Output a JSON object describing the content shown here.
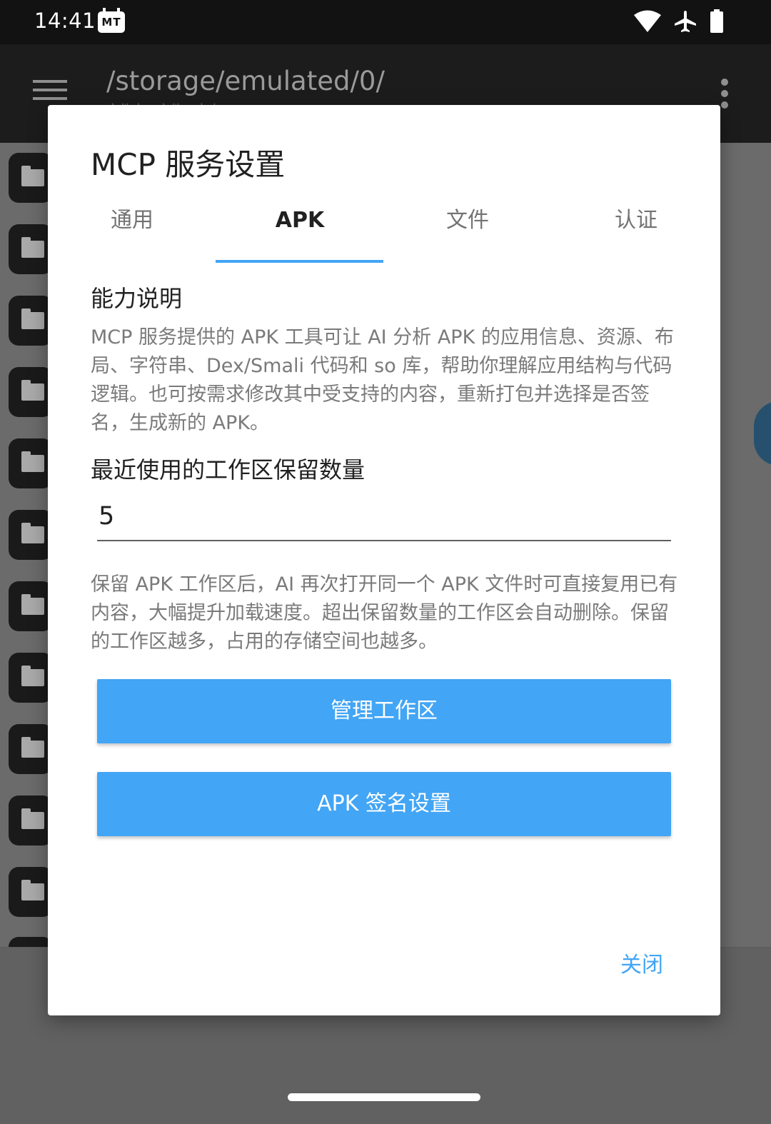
{
  "status_bar": {
    "time": "14:41",
    "app_badge": "MT",
    "icons": [
      "wifi-icon",
      "airplane-icon",
      "battery-icon"
    ]
  },
  "app_bar": {
    "path": "/storage/emulated/0/",
    "subtitle": "文件夹 · 文件 · 大小"
  },
  "dialog": {
    "title": "MCP 服务设置",
    "tabs": [
      {
        "label": "通用",
        "active": false
      },
      {
        "label": "APK",
        "active": true
      },
      {
        "label": "文件",
        "active": false
      },
      {
        "label": "认证",
        "active": false
      }
    ],
    "capability": {
      "heading": "能力说明",
      "text": "MCP 服务提供的 APK 工具可让 AI 分析 APK 的应用信息、资源、布局、字符串、Dex/Smali 代码和 so 库，帮助你理解应用结构与代码逻辑。也可按需求修改其中受支持的内容，重新打包并选择是否签名，生成新的 APK。"
    },
    "workspace": {
      "heading": "最近使用的工作区保留数量",
      "value": "5",
      "note": "保留 APK 工作区后，AI 再次打开同一个 APK 文件时可直接复用已有内容，大幅提升加载速度。超出保留数量的工作区会自动删除。保留的工作区越多，占用的存储空间也越多。"
    },
    "buttons": {
      "manage": "管理工作区",
      "signing": "APK 签名设置",
      "close": "关闭"
    }
  },
  "colors": {
    "accent": "#42a5f5",
    "scrim": "#6b6b6b",
    "app_bar": "#1c1c1c"
  }
}
